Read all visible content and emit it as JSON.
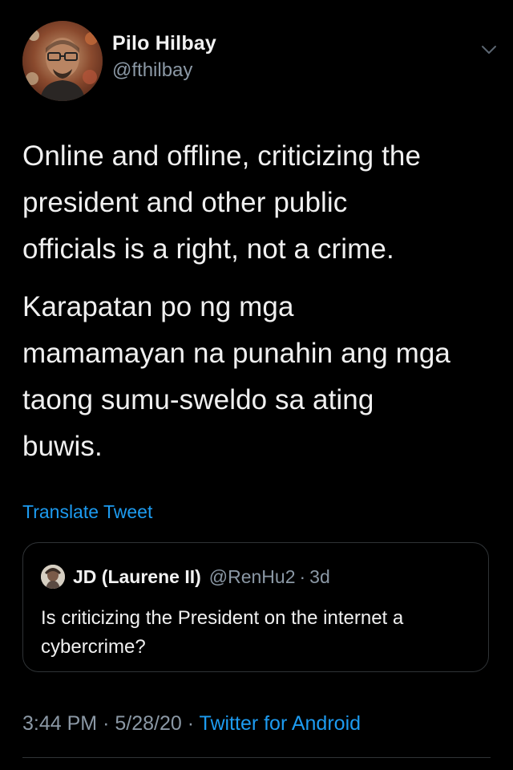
{
  "tweet": {
    "author": {
      "display_name": "Pilo Hilbay",
      "handle": "@fthilbay",
      "avatar_icon": "profile-photo"
    },
    "menu_icon": "chevron-down-icon",
    "paragraphs": [
      "Online and offline, criticizing the\npresident and other public\nofficials is a right, not a crime.",
      "Karapatan po ng mga\nmamamayan na punahin ang mga\ntaong sumu-sweldo sa ating\nbuwis."
    ],
    "translate_label": "Translate Tweet",
    "quoted": {
      "display_name": "JD (Laurene II)",
      "handle": "@RenHu2",
      "separator": "·",
      "age": "3d",
      "text": "Is criticizing the President on the internet a cybercrime?"
    },
    "meta": {
      "time": "3:44 PM",
      "separator1": "·",
      "date": "5/28/20",
      "separator2": "·",
      "source": "Twitter for Android"
    }
  },
  "colors": {
    "background": "#000000",
    "text": "#f0f0f0",
    "muted": "#8b98a5",
    "link": "#1d9bf0",
    "border": "#2f3336"
  }
}
